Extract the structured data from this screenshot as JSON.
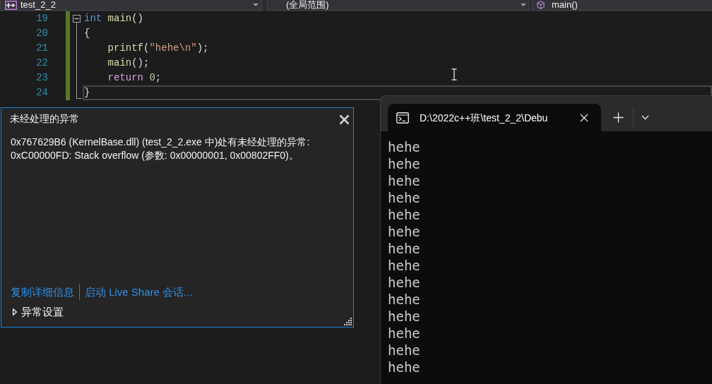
{
  "navigation_bar": {
    "dropdowns": [
      {
        "kind": "project",
        "value": "test_2_2"
      },
      {
        "kind": "scope",
        "value": "(全局范围)"
      },
      {
        "kind": "function",
        "value": "main()"
      }
    ]
  },
  "editor": {
    "lines": [
      {
        "number": "19",
        "changed": true,
        "current": false,
        "expanded": true,
        "tokens": [
          {
            "text": "int ",
            "kind": "keyword"
          },
          {
            "text": "main",
            "kind": "function"
          },
          {
            "text": "()",
            "kind": "plain"
          }
        ],
        "children": [
          {
            "number": "20",
            "changed": true,
            "current": false,
            "tokens": [
              {
                "text": "{",
                "kind": "plain"
              }
            ]
          },
          {
            "number": "21",
            "changed": true,
            "current": false,
            "tokens": [
              {
                "text": "    printf",
                "kind": "function"
              },
              {
                "text": "(",
                "kind": "plain"
              },
              {
                "text": "\"hehe\\n\"",
                "kind": "string"
              },
              {
                "text": ");",
                "kind": "plain"
              }
            ]
          },
          {
            "number": "22",
            "changed": true,
            "current": false,
            "tokens": [
              {
                "text": "    main",
                "kind": "function"
              },
              {
                "text": "();",
                "kind": "plain"
              }
            ]
          },
          {
            "number": "23",
            "changed": true,
            "current": false,
            "tokens": [
              {
                "text": "    return ",
                "kind": "control"
              },
              {
                "text": "0",
                "kind": "number"
              },
              {
                "text": ";",
                "kind": "plain"
              }
            ]
          },
          {
            "number": "24",
            "changed": true,
            "current": true,
            "tokens": [
              {
                "text": "}",
                "kind": "plain"
              }
            ]
          }
        ]
      }
    ]
  },
  "exception_popup": {
    "title": "未经处理的异常",
    "message": "0x767629B6 (KernelBase.dll) (test_2_2.exe 中)处有未经处理的异常: 0xC00000FD: Stack overflow (参数: 0x00000001, 0x00802FF0)。",
    "links": [
      "复制详细信息",
      "启动 Live Share 会话..."
    ],
    "settings": {
      "label": "异常设置",
      "expanded": false
    }
  },
  "terminal": {
    "tabs": [
      {
        "title": "D:\\2022c++班\\test_2_2\\Debu",
        "selected": true
      }
    ],
    "output": [
      "hehe",
      "hehe",
      "hehe",
      "hehe",
      "hehe",
      "hehe",
      "hehe",
      "hehe",
      "hehe",
      "hehe",
      "hehe",
      "hehe",
      "hehe",
      "hehe"
    ]
  }
}
